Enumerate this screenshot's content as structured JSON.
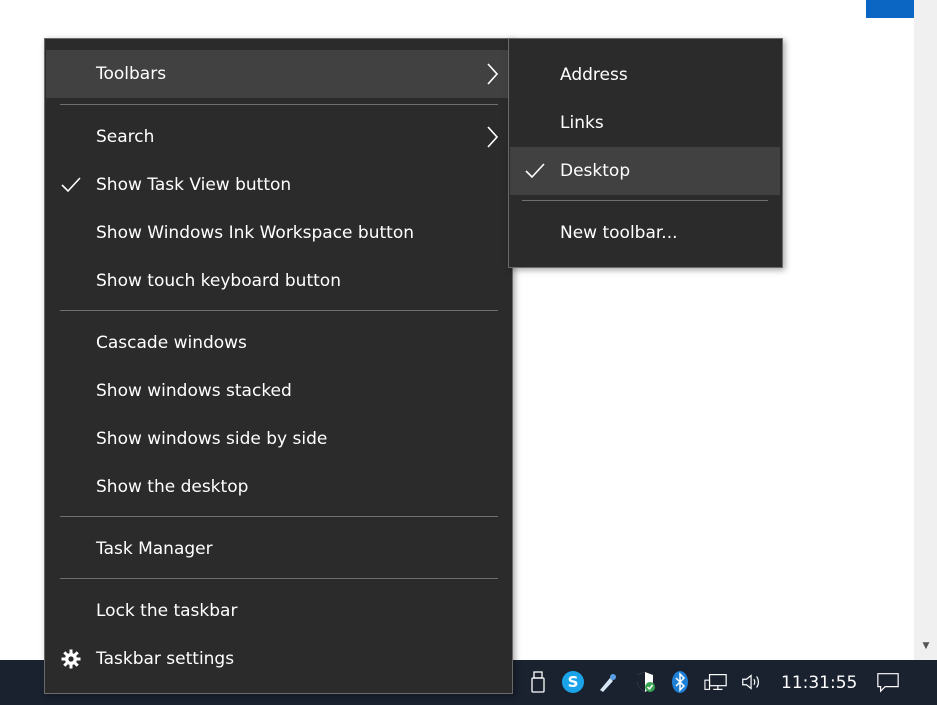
{
  "context_menu": {
    "toolbars": "Toolbars",
    "search": "Search",
    "show_task_view": "Show Task View button",
    "show_ink_workspace": "Show Windows Ink Workspace button",
    "show_touch_keyboard": "Show touch keyboard button",
    "cascade": "Cascade windows",
    "stacked": "Show windows stacked",
    "side_by_side": "Show windows side by side",
    "show_desktop": "Show the desktop",
    "task_manager": "Task Manager",
    "lock_taskbar": "Lock the taskbar",
    "taskbar_settings": "Taskbar settings"
  },
  "toolbars_submenu": {
    "address": "Address",
    "links": "Links",
    "desktop": "Desktop",
    "new_toolbar": "New toolbar..."
  },
  "taskbar": {
    "clock": "11:31:55",
    "tray_icons": [
      "usb-drive-icon",
      "skype-icon",
      "pen-tool-icon",
      "windows-defender-icon",
      "bluetooth-icon",
      "network-icon",
      "volume-icon",
      "action-center-icon"
    ]
  },
  "colors": {
    "menu_bg": "#2b2b2b",
    "menu_highlight": "#414141",
    "taskbar_bg": "#1a2230",
    "accent": "#0a66c2"
  }
}
